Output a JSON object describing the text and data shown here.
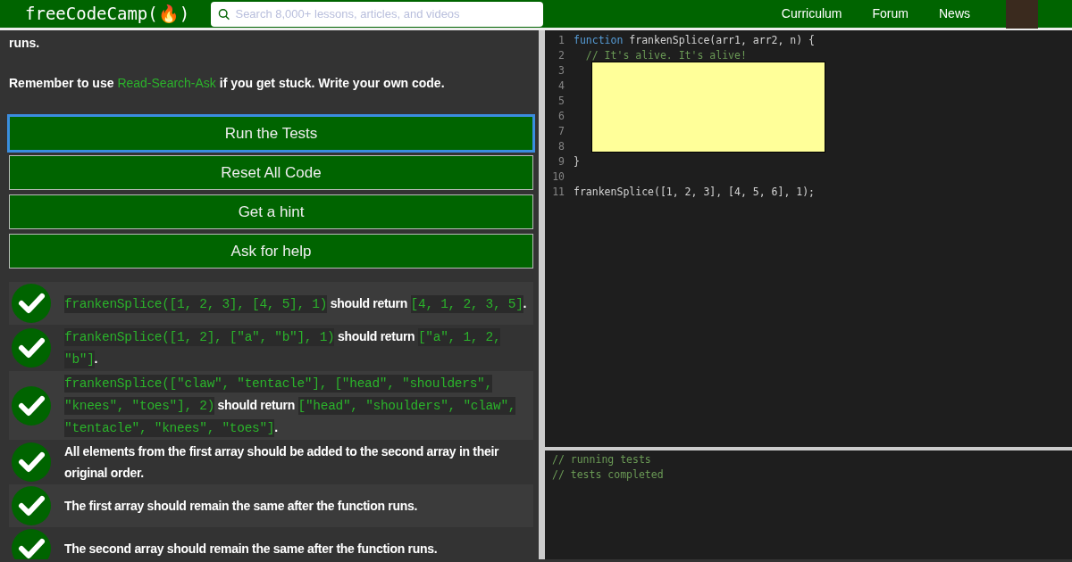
{
  "navbar": {
    "logo": "freeCodeCamp(🔥)",
    "search": {
      "placeholder": "Search 8,000+ lessons, articles, and videos"
    },
    "links": [
      "Curriculum",
      "Forum",
      "News"
    ]
  },
  "instructions": {
    "tail": "runs.",
    "reminder": [
      {
        "kind": "text",
        "t": "Remember to use "
      },
      {
        "kind": "link",
        "t": "Read-Search-Ask"
      },
      {
        "kind": "text",
        "t": " if you get stuck. Write your own code."
      }
    ]
  },
  "buttons": [
    {
      "label": "Run the Tests",
      "focused": true
    },
    {
      "label": "Reset All Code",
      "focused": false
    },
    {
      "label": "Get a hint",
      "focused": false
    },
    {
      "label": "Ask for help",
      "focused": false
    }
  ],
  "tests": [
    {
      "passed": true,
      "parts": [
        {
          "kind": "code",
          "t": "frankenSplice([1, 2, 3], [4, 5], 1)"
        },
        {
          "kind": "text",
          "t": " should return "
        },
        {
          "kind": "code",
          "t": "[4, 1, 2, 3, 5]"
        },
        {
          "kind": "text",
          "t": "."
        }
      ]
    },
    {
      "passed": true,
      "parts": [
        {
          "kind": "code",
          "t": "frankenSplice([1, 2], [\"a\", \"b\"], 1)"
        },
        {
          "kind": "text",
          "t": " should return "
        },
        {
          "kind": "code",
          "t": "[\"a\", 1, 2, \"b\"]"
        },
        {
          "kind": "text",
          "t": "."
        }
      ]
    },
    {
      "passed": true,
      "parts": [
        {
          "kind": "code",
          "t": "frankenSplice([\"claw\", \"tentacle\"], [\"head\", \"shoulders\", \"knees\", \"toes\"], 2)"
        },
        {
          "kind": "text",
          "t": " should return "
        },
        {
          "kind": "code",
          "t": "[\"head\", \"shoulders\", \"claw\", \"tentacle\", \"knees\", \"toes\"]"
        },
        {
          "kind": "text",
          "t": "."
        }
      ]
    },
    {
      "passed": true,
      "parts": [
        {
          "kind": "text",
          "t": "All elements from the first array should be added to the second array in their original order."
        }
      ]
    },
    {
      "passed": true,
      "parts": [
        {
          "kind": "text",
          "t": "The first array should remain the same after the function runs."
        }
      ]
    },
    {
      "passed": true,
      "parts": [
        {
          "kind": "text",
          "t": "The second array should remain the same after the function runs."
        }
      ]
    }
  ],
  "editor": {
    "lines": [
      {
        "number": "1",
        "tokens": [
          {
            "kind": "keyword",
            "t": "function"
          },
          {
            "kind": "plain",
            "t": " frankenSplice(arr1, arr2, n) {"
          }
        ]
      },
      {
        "number": "2",
        "tokens": [
          {
            "kind": "comment",
            "t": "  // It's alive. It's alive!"
          }
        ]
      },
      {
        "number": "3"
      },
      {
        "number": "4"
      },
      {
        "number": "5"
      },
      {
        "number": "6"
      },
      {
        "number": "7"
      },
      {
        "number": "8"
      },
      {
        "number": "9",
        "tokens": [
          {
            "kind": "plain",
            "t": "}"
          }
        ]
      },
      {
        "number": "10"
      },
      {
        "number": "11",
        "tokens": [
          {
            "kind": "plain",
            "t": "frankenSplice([1, 2, 3], [4, 5, 6], 1);"
          }
        ]
      }
    ]
  },
  "console": {
    "lines": [
      "// running tests",
      "// tests completed"
    ]
  }
}
